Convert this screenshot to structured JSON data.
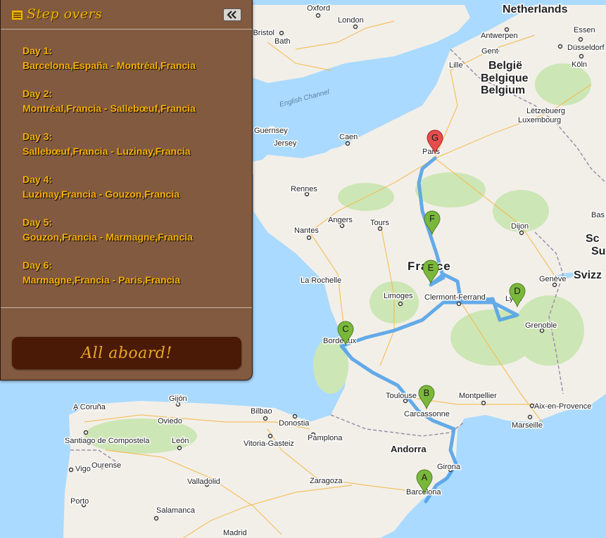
{
  "panel": {
    "title": "Step overs",
    "days": [
      {
        "label": "Day 1:",
        "route": "Barcelona,España - Montréal,Francia"
      },
      {
        "label": "Day 2:",
        "route": "Montréal,Francia - Sallebœuf,Francia"
      },
      {
        "label": "Day 3:",
        "route": "Sallebœuf,Francia - Luzinay,Francia"
      },
      {
        "label": "Day 4:",
        "route": "Luzinay,Francia - Gouzon,Francia"
      },
      {
        "label": "Day 5:",
        "route": "Gouzon,Francia - Marmagne,Francia"
      },
      {
        "label": "Day 6:",
        "route": "Marmagne,Francia - Paris,Francia"
      }
    ],
    "button_label": "All aboard!"
  },
  "map": {
    "colors": {
      "water": "#aadaff",
      "land": "#f2efe9",
      "route": "#4a9de8",
      "marker": "#7ab83c",
      "marker_end": "#e44d4d"
    },
    "markers": [
      {
        "id": "A",
        "letter": "A",
        "place": "Barcelona"
      },
      {
        "id": "B",
        "letter": "B",
        "place": "Carcassonne"
      },
      {
        "id": "C",
        "letter": "C",
        "place": "Bordeaux"
      },
      {
        "id": "D",
        "letter": "D",
        "place": "Lyon"
      },
      {
        "id": "E",
        "letter": "E",
        "place": "Gouzon"
      },
      {
        "id": "F",
        "letter": "F",
        "place": "Marmagne"
      },
      {
        "id": "G",
        "letter": "G",
        "place": "Paris"
      }
    ],
    "labels": {
      "netherlands": "Netherlands",
      "belgie": "België",
      "belgique": "Belgique",
      "belgium": "Belgium",
      "letzeburg": "Lëtzebuerg",
      "luxembourg": "Luxembourg",
      "france": "France",
      "andorra": "Andorra",
      "english_channel": "English Channel",
      "guernsey": "Guernsey",
      "jersey": "Jersey",
      "schweiz": "Sc",
      "suisse": "Su",
      "svizzera": "Svizz",
      "oxford": "Oxford",
      "london": "London",
      "bristol": "Bristol",
      "bath": "Bath",
      "antwerpen": "Antwerpen",
      "gent": "Gent",
      "essen": "Essen",
      "dusseldorf": "Düsseldorf",
      "koln": "Köln",
      "lille": "Lille",
      "caen": "Caen",
      "paris": "Paris",
      "rennes": "Rennes",
      "angers": "Angers",
      "tours": "Tours",
      "nantes": "Nantes",
      "dijon": "Dijon",
      "basel": "Bas",
      "la_rochelle": "La Rochelle",
      "limoges": "Limoges",
      "clermont": "Clermont-Ferrand",
      "lyon": "Lyon",
      "geneve": "Genève",
      "grenoble": "Grenoble",
      "bordeaux": "Bordeaux",
      "toulouse": "Toulouse",
      "carcassonne": "Carcassonne",
      "montpellier": "Montpellier",
      "aix": "Aix-en-Provence",
      "marseille": "Marseille",
      "a_coruna": "A Coruña",
      "gijon": "Gijón",
      "oviedo": "Oviedo",
      "bilbao": "Bilbao",
      "donostia": "Donostia",
      "santiago": "Santiago de Compostela",
      "leon": "León",
      "vitoria": "Vitoria-Gasteiz",
      "pamplona": "Pamplona",
      "vigo": "Vigo",
      "ourense": "Ourense",
      "girona": "Girona",
      "valladolid": "Valladolid",
      "zaragoza": "Zaragoza",
      "barcelona": "Barcelona",
      "porto": "Porto",
      "salamanca": "Salamanca",
      "madrid": "Madrid"
    }
  }
}
